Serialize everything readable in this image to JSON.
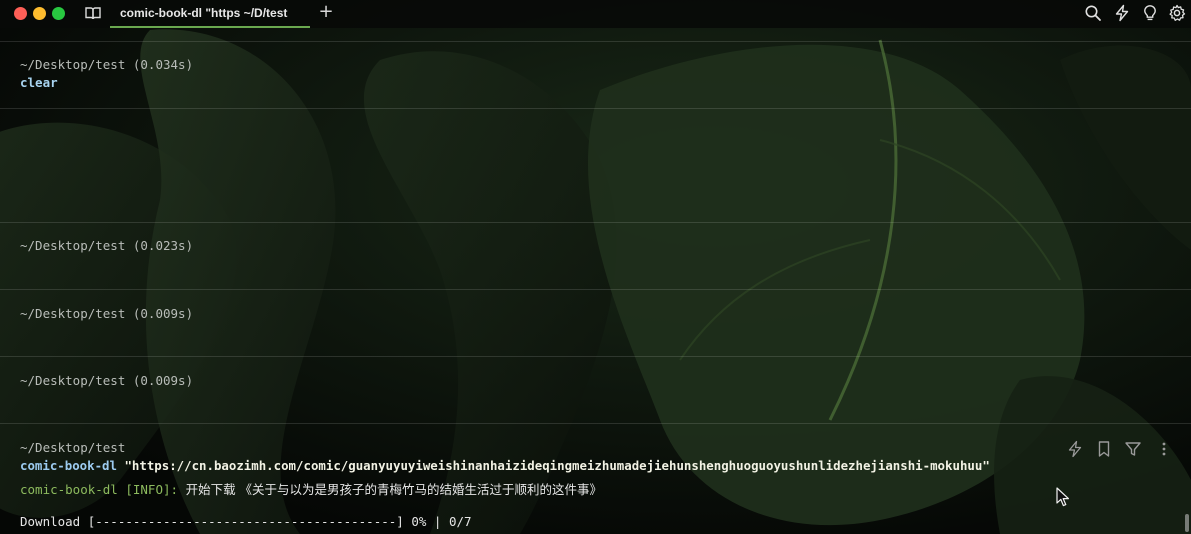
{
  "window": {
    "tab_title": "comic-book-dl \"https ~/D/test",
    "new_tab_label": "+"
  },
  "toolbar": {
    "icons": [
      "search-icon",
      "lightning-icon",
      "lightbulb-icon",
      "gear-icon"
    ]
  },
  "blocks": [
    {
      "path": "~/Desktop/test (0.034s)",
      "command": "clear"
    },
    {
      "path": "~/Desktop/test (0.023s)"
    },
    {
      "path": "~/Desktop/test (0.009s)"
    },
    {
      "path": "~/Desktop/test (0.009s)"
    }
  ],
  "active_block": {
    "path": "~/Desktop/test",
    "command_name": "comic-book-dl",
    "command_arg": " \"https://cn.baozimh.com/comic/guanyuyuyiweishinanhaizideqingmeizhumadejiehunshenghuoguoyushunlidezhejianshi-mokuhuu\"",
    "info_tag": "comic-book-dl [INFO]: ",
    "info_text": "开始下载 《关于与以为是男孩子的青梅竹马的结婚生活过于顺利的这件事》",
    "progress": "Download [----------------------------------------] 0% | 0/7",
    "actions": [
      "lightning-icon",
      "bookmark-icon",
      "filter-icon",
      "more-icon"
    ]
  },
  "colors": {
    "accent_tab": "#6aa84f",
    "info_green": "#8dbb5e",
    "command_blue": "#9ccbf0"
  }
}
